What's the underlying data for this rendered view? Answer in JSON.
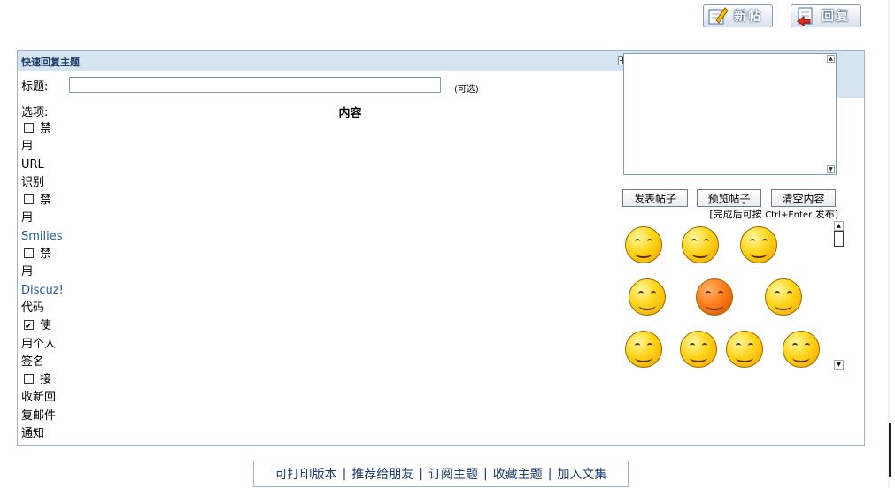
{
  "toolbar": {
    "new_post_label": "新帖",
    "reply_label": "回复"
  },
  "quick_reply": {
    "title": "快速回复主题",
    "subject_label": "标题:",
    "subject_value": "",
    "optional_label": "(可选)",
    "options_title": "选项:",
    "content_title": "内容",
    "options": [
      {
        "checked": false,
        "text_lines": [
          "禁",
          "用",
          "URL",
          "识别"
        ],
        "blue_line": -1
      },
      {
        "checked": false,
        "text_lines": [
          "禁",
          "用",
          "Smilies"
        ],
        "blue_line": 2
      },
      {
        "checked": false,
        "text_lines": [
          "禁",
          "用",
          "Discuz!",
          "代码"
        ],
        "blue_line": 2
      },
      {
        "checked": true,
        "text_lines": [
          "使",
          "用个人",
          "签名"
        ],
        "blue_line": -1
      },
      {
        "checked": false,
        "text_lines": [
          "接",
          "收新回",
          "复邮件",
          "通知"
        ],
        "blue_line": -1
      }
    ],
    "buttons": {
      "submit": "发表帖子",
      "preview": "预览帖子",
      "clear": "清空内容"
    },
    "hint_prefix": "[完成后可按",
    "hint_keys": "Ctrl+Enter",
    "hint_suffix": "发布]",
    "smilies": [
      "tongue-smiley",
      "drool-smiley",
      "laugh-smiley",
      "megaphone-smiley",
      "angry-smiley",
      "shy-smiley",
      "peace-smiley",
      "sleepy-smiley",
      "thinking-smiley",
      "dizzy-smiley"
    ]
  },
  "footer": {
    "links": [
      "可打印版本",
      "推荐给朋友",
      "订阅主题",
      "收藏主题",
      "加入文集"
    ],
    "separator": "|"
  }
}
